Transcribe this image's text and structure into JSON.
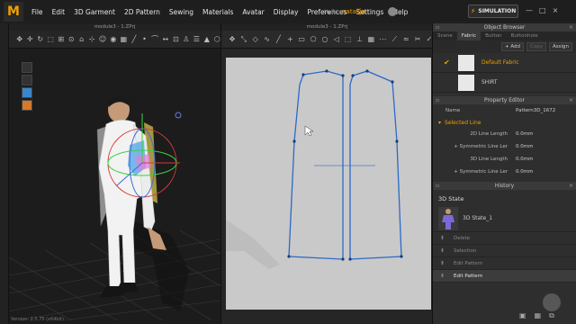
{
  "app": {
    "logo_letter": "M",
    "menu": [
      "File",
      "Edit",
      "3D Garment",
      "2D Pattern",
      "Sewing",
      "Materials",
      "Avatar",
      "Display",
      "Preferences",
      "Settings",
      "Help"
    ],
    "user_label": "Hello,",
    "user_name": "natalija",
    "simulation_label": "SIMULATION",
    "window_controls": [
      "—",
      "□",
      "×"
    ],
    "version": "Version: 2.5.75  (x64bit)"
  },
  "view3d": {
    "title": "module3 - 1.ZPrj",
    "toolbar_icons": [
      "select-icon",
      "move-icon",
      "rotate-icon",
      "box-select-icon",
      "arrange-icon",
      "pin-icon",
      "fold-icon",
      "tack-icon",
      "avatar-icon",
      "camera-icon",
      "texture-icon",
      "line-icon",
      "point-icon",
      "drape-icon",
      "measure-icon",
      "fit-icon",
      "shirt-icon",
      "layer-icon",
      "strength-icon",
      "unwrap-icon"
    ]
  },
  "view2d": {
    "title": "module3 - 1.ZPrj",
    "toolbar_icons": [
      "select-icon",
      "transform-icon",
      "edit-point-icon",
      "curve-icon",
      "internal-line-icon",
      "add-point-icon",
      "rect-icon",
      "polygon-icon",
      "circle-icon",
      "dart-icon",
      "trace-icon",
      "notch-icon",
      "grid-icon",
      "seam-icon",
      "segment-icon",
      "free-seam-icon",
      "sew-icon",
      "check-icon",
      "zoom-icon"
    ]
  },
  "object_browser": {
    "title": "Object Browser",
    "tabs": [
      "Scene",
      "Fabric",
      "Button",
      "Buttonhole"
    ],
    "active_tab": "Fabric",
    "add_label": "+ Add",
    "copy_label": "Copy",
    "assign_label": "Assign",
    "fabrics": [
      {
        "name": "Default Fabric",
        "selected": true
      },
      {
        "name": "SHIRT",
        "selected": false
      }
    ]
  },
  "property_editor": {
    "title": "Property Editor",
    "name_label": "Name",
    "name_value": "Pattern3D_1672",
    "section": "Selected Line",
    "rows": [
      {
        "label": "2D Line Length",
        "value": "0.0mm"
      },
      {
        "label": "+ Symmetric Line Ler",
        "value": "0.0mm"
      },
      {
        "label": "3D Line Length",
        "value": "0.0mm"
      },
      {
        "label": "+ Symmetric Line Ler",
        "value": "0.0mm"
      }
    ]
  },
  "history": {
    "title": "History",
    "state_label": "3D State",
    "state_item": "3D State_1",
    "items": [
      {
        "label": "Delete",
        "active": false
      },
      {
        "label": "Selection",
        "active": false
      },
      {
        "label": "Edit Pattern",
        "active": false
      },
      {
        "label": "Edit Pattern",
        "active": true
      }
    ]
  }
}
